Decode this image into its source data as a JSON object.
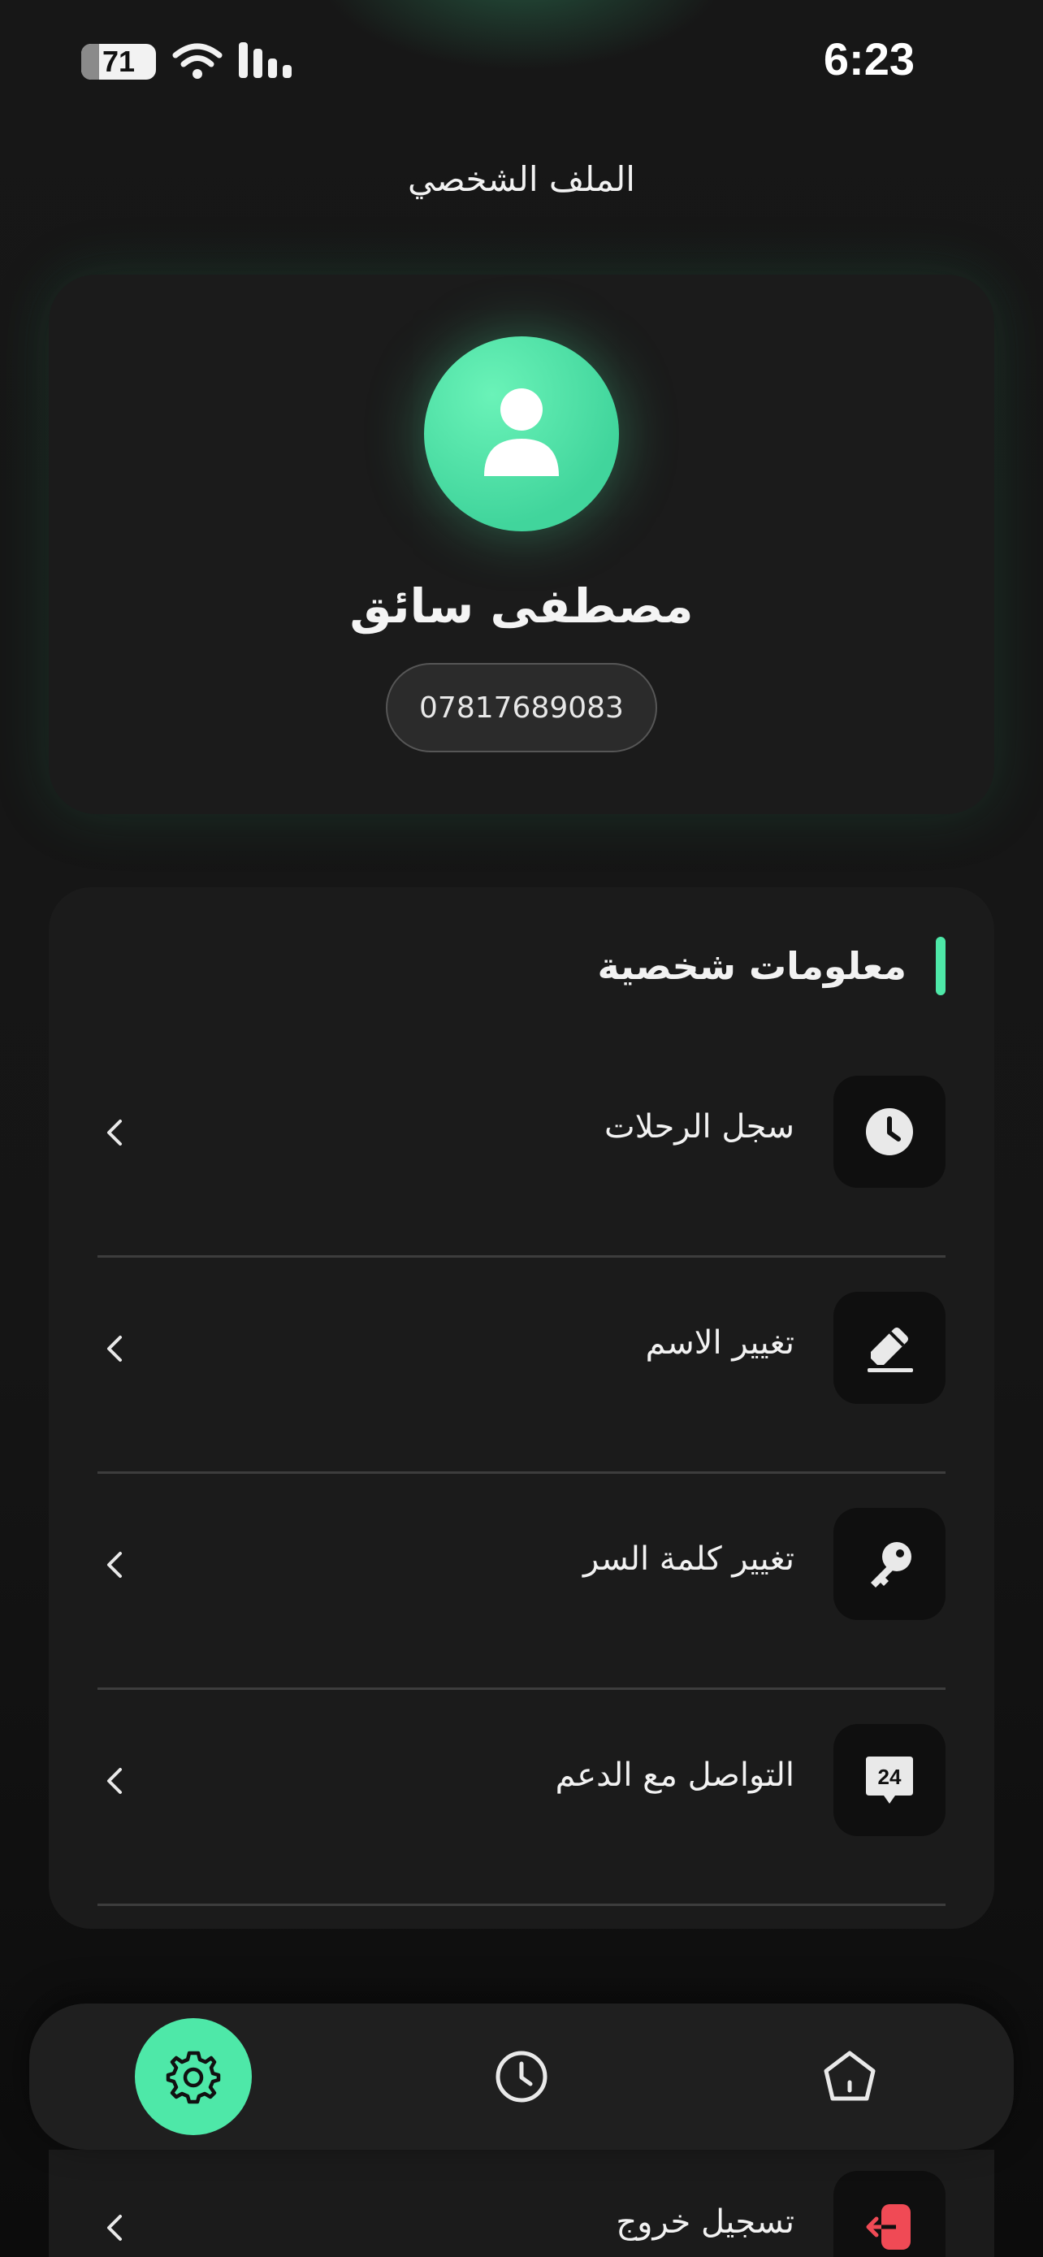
{
  "status_bar": {
    "time": "6:23",
    "battery": "71"
  },
  "header": {
    "title": "الملف الشخصي"
  },
  "profile": {
    "name": "مصطفى سائق",
    "phone": "07817689083"
  },
  "personal_info": {
    "title": "معلومات شخصية",
    "items": [
      {
        "label": "سجل الرحلات",
        "icon": "clock-icon"
      },
      {
        "label": "تغيير الاسم",
        "icon": "edit-pen-icon"
      },
      {
        "label": "تغيير كلمة السر",
        "icon": "key-icon"
      },
      {
        "label": "التواصل مع الدعم",
        "icon": "support-24-icon",
        "icon_text": "24"
      }
    ],
    "logout": {
      "label": "تسجيل خروج",
      "icon": "logout-icon"
    }
  },
  "bottom_nav": {
    "items": [
      "settings-icon",
      "history-icon",
      "home-icon"
    ],
    "active": "settings-icon"
  },
  "colors": {
    "accent": "#4ee8a8",
    "background": "#151515",
    "card": "#1b1b1b",
    "danger": "#f04a55"
  }
}
